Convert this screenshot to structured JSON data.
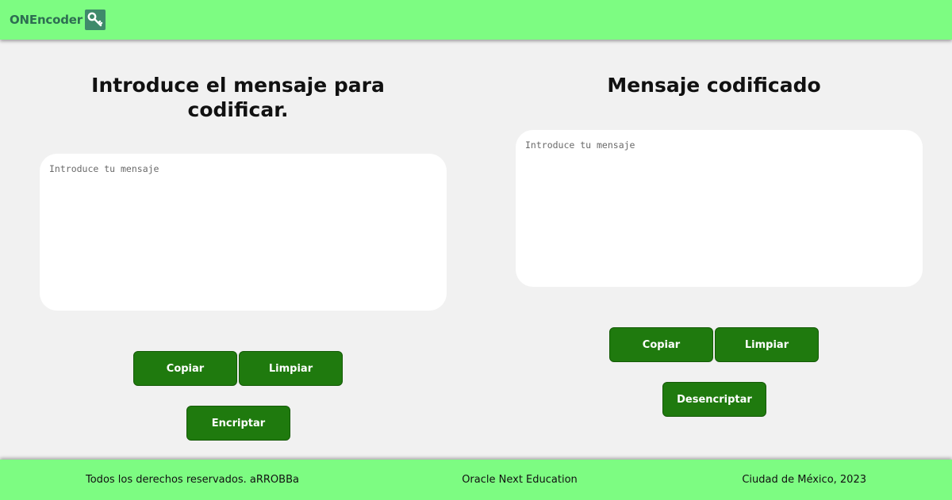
{
  "header": {
    "brand": "ONEncoder",
    "logo_icon": "key-icon",
    "logo_color": "#3f8a6b",
    "background": "#7dfc82"
  },
  "encoder": {
    "title": "Introduce el mensaje para codificar.",
    "input_placeholder": "Introduce tu mensaje",
    "input_value": "",
    "copy_label": "Copiar",
    "clear_label": "Limpiar",
    "action_label": "Encriptar"
  },
  "decoder": {
    "title": "Mensaje codificado",
    "input_placeholder": "Introduce tu mensaje",
    "input_value": "",
    "copy_label": "Copiar",
    "clear_label": "Limpiar",
    "action_label": "Desencriptar"
  },
  "footer": {
    "rights": "Todos los derechos reservados. aRROBBa",
    "program": "Oracle Next Education",
    "location": "Ciudad de México, 2023"
  },
  "colors": {
    "accent": "#7dfc82",
    "button": "#1f7a0e",
    "page_background": "#f1f1f1"
  }
}
